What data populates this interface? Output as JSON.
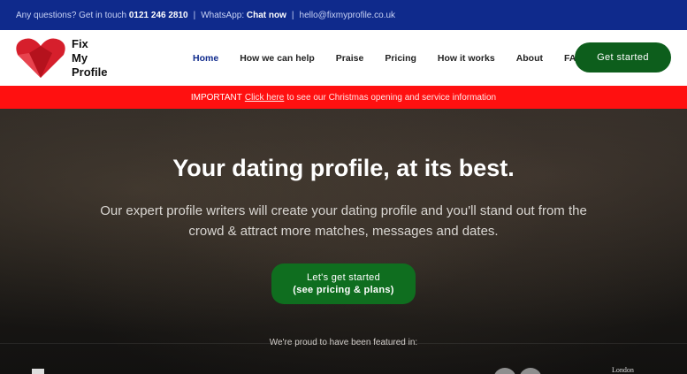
{
  "topbar": {
    "questions": "Any questions? Get in touch",
    "phone": "0121 246 2810",
    "sep1": "|",
    "whatsapp_label": "WhatsApp:",
    "chat": "Chat now",
    "sep2": "|",
    "email": "hello@fixmyprofile.co.uk"
  },
  "logo": {
    "line1": "Fix",
    "line2": "My",
    "line3": "Profile",
    "color": "#d61f2c"
  },
  "nav": {
    "items": [
      "Home",
      "How we can help",
      "Praise",
      "Pricing",
      "How it works",
      "About",
      "FAQs"
    ],
    "cta": "Get started"
  },
  "alert": {
    "important": "IMPORTANT",
    "link": "Click here",
    "rest": "to see our Christmas opening and service information"
  },
  "hero": {
    "title": "Your dating profile, at its best.",
    "subtitle": "Our expert profile writers will create your dating profile and you'll stand out from the crowd & attract more matches, messages and dates.",
    "button_line1": "Let's get started",
    "button_line2": "(see pricing & plans)",
    "featured": "We're proud to have been featured in:",
    "press_london": "London"
  },
  "colors": {
    "topbar": "#0f2a8c",
    "alert": "#ff1010",
    "cta": "#0d5e1c"
  }
}
